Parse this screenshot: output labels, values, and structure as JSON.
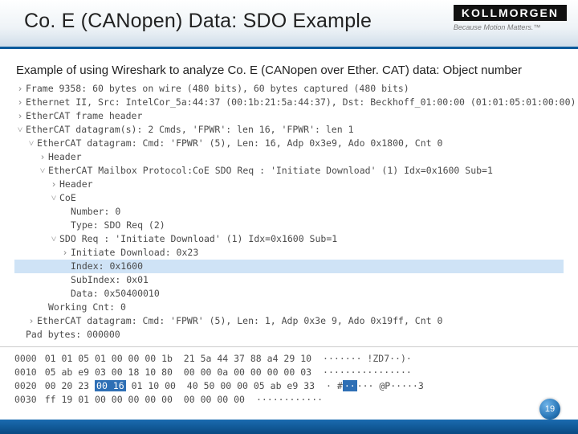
{
  "header": {
    "title": "Co. E (CANopen) Data: SDO Example",
    "brand": "KOLLMORGEN",
    "tagline": "Because Motion Matters.™"
  },
  "subtitle": "Example of using Wireshark to analyze Co. E (CANopen over Ether. CAT) data: Object number",
  "tree": {
    "l0": "Frame 9358: 60 bytes on wire (480 bits), 60 bytes captured (480 bits)",
    "l1": "Ethernet II, Src: IntelCor_5a:44:37 (00:1b:21:5a:44:37), Dst: Beckhoff_01:00:00 (01:01:05:01:00:00)",
    "l2": "EtherCAT frame header",
    "l3": "EtherCAT datagram(s): 2 Cmds, 'FPWR': len 16, 'FPWR': len 1",
    "l4": "EtherCAT datagram: Cmd: 'FPWR' (5), Len: 16, Adp 0x3e9, Ado 0x1800, Cnt 0",
    "l5": "Header",
    "l6": "EtherCAT Mailbox Protocol:CoE SDO Req : 'Initiate Download' (1) Idx=0x1600 Sub=1",
    "l7": "Header",
    "l8": "CoE",
    "l9": "Number: 0",
    "l10": "Type: SDO Req (2)",
    "l11": "SDO Req : 'Initiate Download' (1) Idx=0x1600 Sub=1",
    "l12": "Initiate Download: 0x23",
    "l13": "Index: 0x1600",
    "l14": "SubIndex: 0x01",
    "l15": "Data: 0x50400010",
    "l16": "Working Cnt: 0",
    "l17": "EtherCAT datagram: Cmd: 'FPWR' (5), Len: 1, Adp 0x3e 9, Ado 0x19ff, Cnt 0",
    "l18": "Pad bytes: 000000"
  },
  "hex": {
    "r0": {
      "addr": "0000",
      "b": "01 01 05 01 00 00 00 1b  21 5a 44 37 88 a4 29 10",
      "a": "······· !ZD7··)·"
    },
    "r1": {
      "addr": "0010",
      "b": "05 ab e9 03 00 18 10 80  00 00 0a 00 00 00 00 03",
      "a": "················"
    },
    "r2": {
      "addr": "0020",
      "b": "00 20 23 ",
      "bhl": "00 16",
      "b2": " 01 10 00  40 50 00 00 05 ab e9 33",
      "a": "· #",
      "ahl": "··",
      "a2": "··· @P·····3"
    },
    "r3": {
      "addr": "0030",
      "b": "ff 19 01 00 00 00 00 00  00 00 00 00",
      "a": "············"
    }
  },
  "page_number": "19",
  "glyphs": {
    "right": "›",
    "down": "˅"
  }
}
